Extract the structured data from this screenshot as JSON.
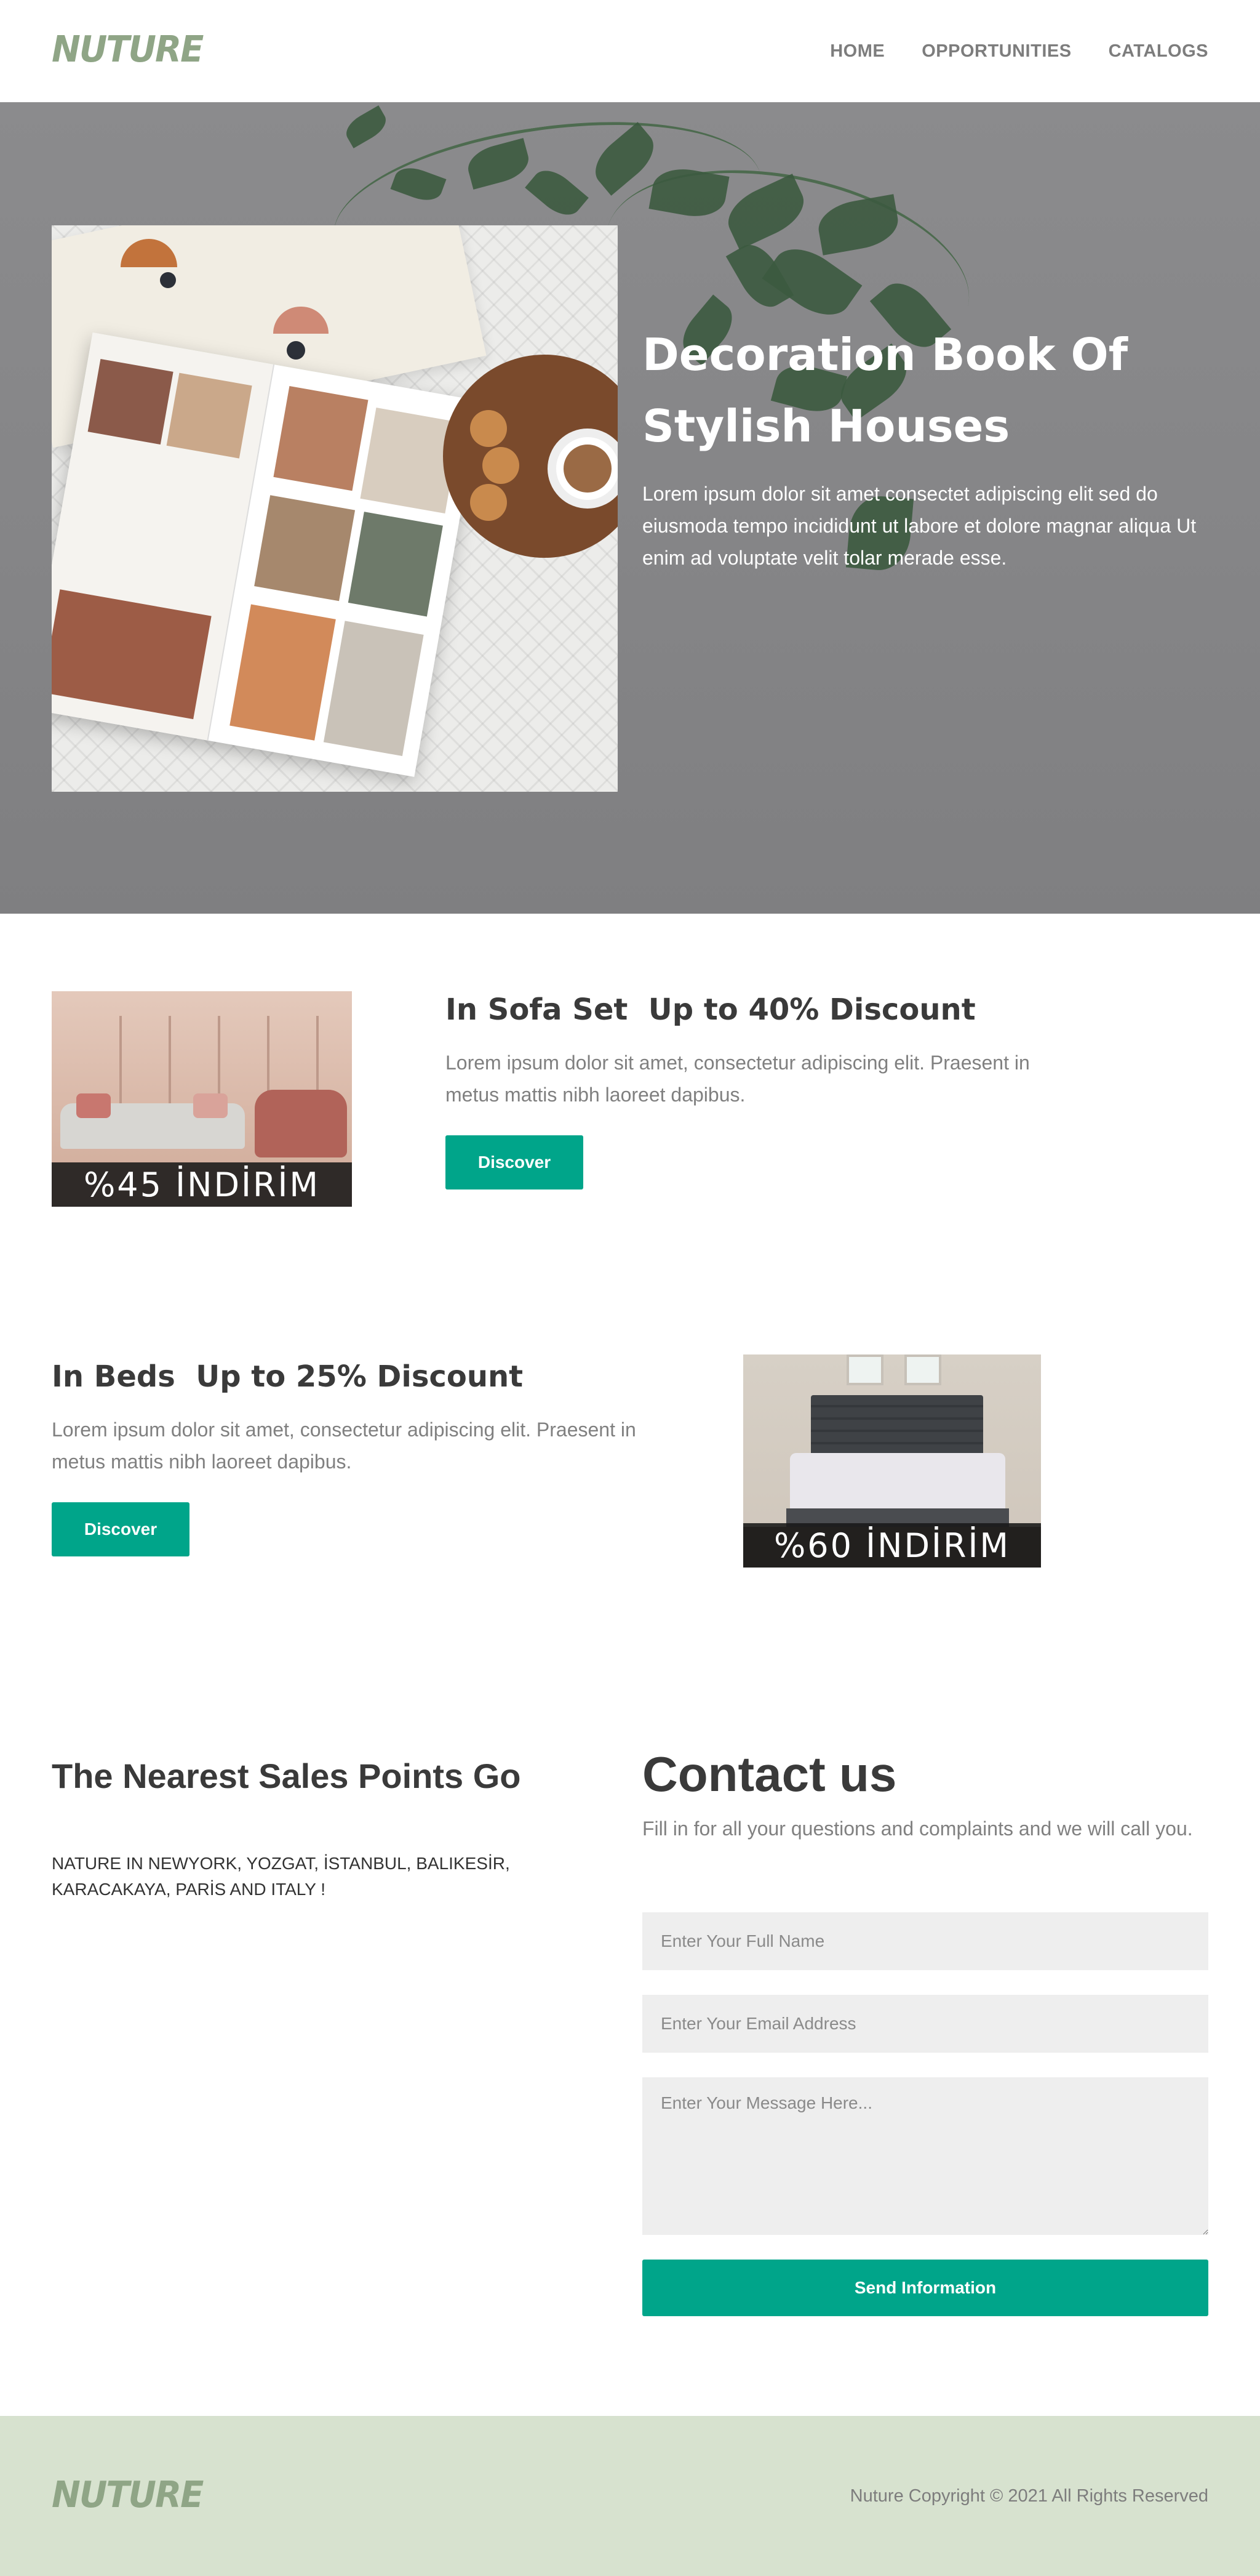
{
  "brand": {
    "logo_text": "NUTURE",
    "accent_color": "#00a58a",
    "logo_color": "#8fa586",
    "footer_bg": "#d7e2cf"
  },
  "nav": {
    "items": [
      "HOME",
      "OPPORTUNITIES",
      "CATALOGS"
    ]
  },
  "hero": {
    "title": "Decoration Book Of Stylish Houses",
    "text": "Lorem ipsum dolor sit amet consectet adipiscing elit sed do eiusmoda tempo incididunt ut labore et dolore magnar aliqua Ut enim ad voluptate velit tolar merade esse."
  },
  "promos": [
    {
      "title": "In Sofa Set  Up to 40% Discount",
      "text": "Lorem ipsum dolor sit amet, consectetur adipiscing elit. Praesent in metus mattis nibh laoreet dapibus.",
      "button": "Discover",
      "banner": "%45 İNDİRİM"
    },
    {
      "title": "In Beds  Up to 25% Discount",
      "text": "Lorem ipsum dolor sit amet, consectetur adipiscing elit. Praesent in metus mattis nibh laoreet dapibus.",
      "button": "Discover",
      "banner": "%60 İNDİRİM"
    }
  ],
  "sales": {
    "title": "The Nearest Sales Points Go",
    "text": "NATURE IN NEWYORK, YOZGAT, İSTANBUL, BALIKESİR, KARACAKAYA, PARİS AND ITALY !"
  },
  "contact": {
    "title": "Contact us",
    "text": "Fill in for all your questions and complaints and we will call you.",
    "name_placeholder": "Enter Your Full Name",
    "email_placeholder": "Enter Your Email Address",
    "message_placeholder": "Enter Your Message Here...",
    "submit": "Send Information"
  },
  "footer": {
    "logo_text": "NUTURE",
    "copyright": "Nuture Copyright © 2021 All Rights Reserved"
  }
}
